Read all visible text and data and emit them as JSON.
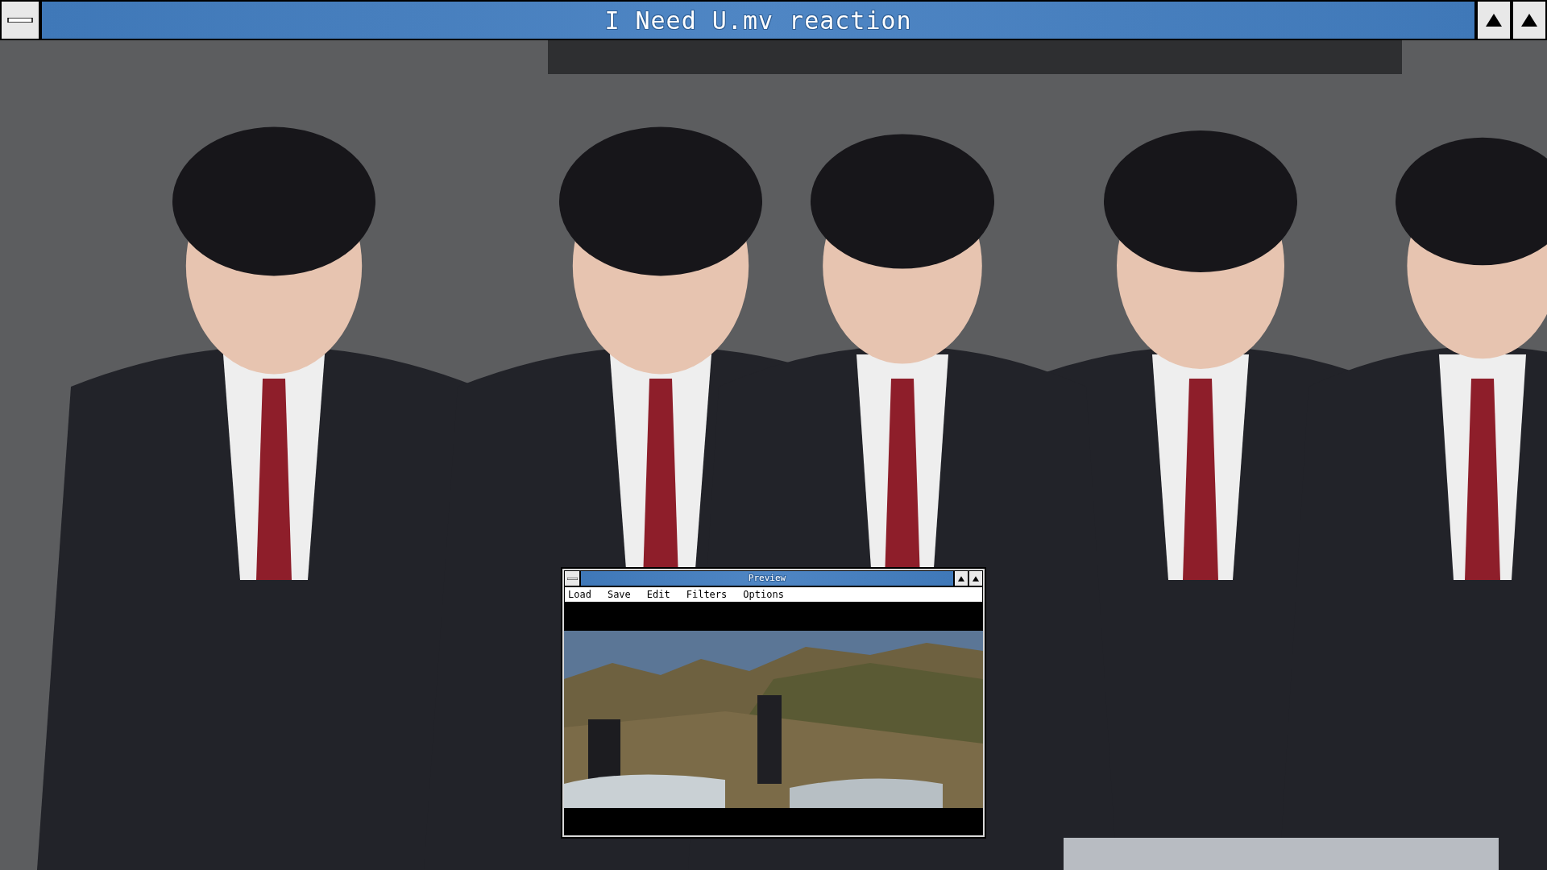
{
  "window": {
    "title": "I Need U.mv reaction"
  },
  "preview": {
    "title": "Preview",
    "menu": [
      "Load",
      "Save",
      "Edit",
      "Filters",
      "Options"
    ]
  }
}
